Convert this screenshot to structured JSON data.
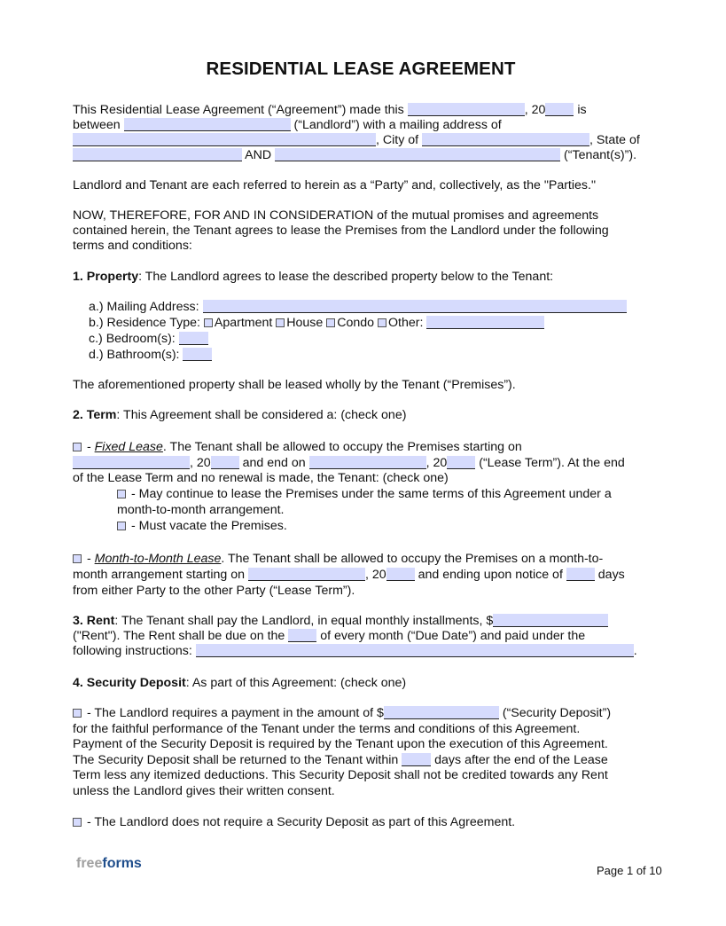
{
  "document": {
    "title": "RESIDENTIAL LEASE AGREEMENT",
    "intro": {
      "l1_a": "This Residential Lease Agreement (“Agreement”) made this",
      "l1_b": ", 20",
      "l1_c": "is",
      "l2_a": "between",
      "l2_b": "(“Landlord”) with a mailing address of",
      "l3_a": ", City of",
      "l3_b": ", State of",
      "l4_a": "AND",
      "l4_b": "(“Tenant(s)”)."
    },
    "parties": "Landlord and Tenant are each referred to herein as a “Party” and, collectively, as the \"Parties.\"",
    "now_therefore": [
      "NOW, THEREFORE, FOR AND IN CONSIDERATION of the mutual promises and agreements",
      "contained herein, the Tenant agrees to lease the Premises from the Landlord under the following",
      "terms and conditions:"
    ],
    "property": {
      "heading": "1. Property",
      "text": ": The Landlord agrees to lease the described property below to the Tenant:",
      "mailing": "a.) Mailing Address:",
      "residence": "b.) Residence Type:",
      "options": [
        "Apartment",
        "House",
        "Condo",
        "Other:"
      ],
      "bedrooms": "c.) Bedroom(s):",
      "bathrooms": "d.) Bathroom(s):",
      "premises": "The aforementioned property shall be leased wholly by the Tenant (“Premises”)."
    },
    "term": {
      "heading": "2. Term",
      "text": ": This Agreement shall be considered a: (check one)",
      "fixed_label": "Fixed Lease",
      "fixed_l1": ". The Tenant shall be allowed to occupy the Premises starting on",
      "fixed_l2_a": ", 20",
      "fixed_l2_b": "and end on",
      "fixed_l2_c": ", 20",
      "fixed_l2_d": "(“Lease Term”). At the end",
      "fixed_l3": "of the Lease Term and no renewal is made, the Tenant: (check one)",
      "opt1_l1": "- May continue to lease the Premises under the same terms of this Agreement under a",
      "opt1_l2": "month-to-month arrangement.",
      "opt2": "- Must vacate the Premises.",
      "mtm_label": "Month-to-Month Lease",
      "mtm_l1": ". The Tenant shall be allowed to occupy the Premises on a month-to-",
      "mtm_l2_a": "month arrangement starting on",
      "mtm_l2_b": ", 20",
      "mtm_l2_c": "and ending upon notice of",
      "mtm_l2_d": "days",
      "mtm_l3": "from either Party to the other Party (“Lease Term”)."
    },
    "rent": {
      "heading": "3. Rent",
      "l1": ": The Tenant shall pay the Landlord, in equal monthly installments, $",
      "l2_a": "(\"Rent\"). The Rent shall be due on the",
      "l2_b": "of every month (“Due Date”) and paid under the",
      "l3": "following instructions:",
      "l3_end": "."
    },
    "deposit": {
      "heading": "4. Security Deposit",
      "text": ": As part of this Agreement: (check one)",
      "req_l1_a": "- The Landlord requires a payment in the amount of $",
      "req_l1_b": "(“Security Deposit”)",
      "req_l2": "for the faithful performance of the Tenant under the terms and conditions of this Agreement.",
      "req_l3": "Payment of the Security Deposit is required by the Tenant upon the execution of this Agreement.",
      "req_l4_a": "The Security Deposit shall be returned to the Tenant within",
      "req_l4_b": "days after the end of the Lease",
      "req_l5": "Term less any itemized deductions. This Security Deposit shall not be credited towards any Rent",
      "req_l6": "unless the Landlord gives their written consent.",
      "none": "- The Landlord does not require a Security Deposit as part of this Agreement."
    }
  },
  "footer": {
    "logo_free": "free",
    "logo_forms": "forms",
    "page": "Page 1 of 10"
  },
  "colors": {
    "field_highlight": "#d6dbfd",
    "logo_blue": "#1f4e8c",
    "logo_gray": "#a0a0a0"
  }
}
